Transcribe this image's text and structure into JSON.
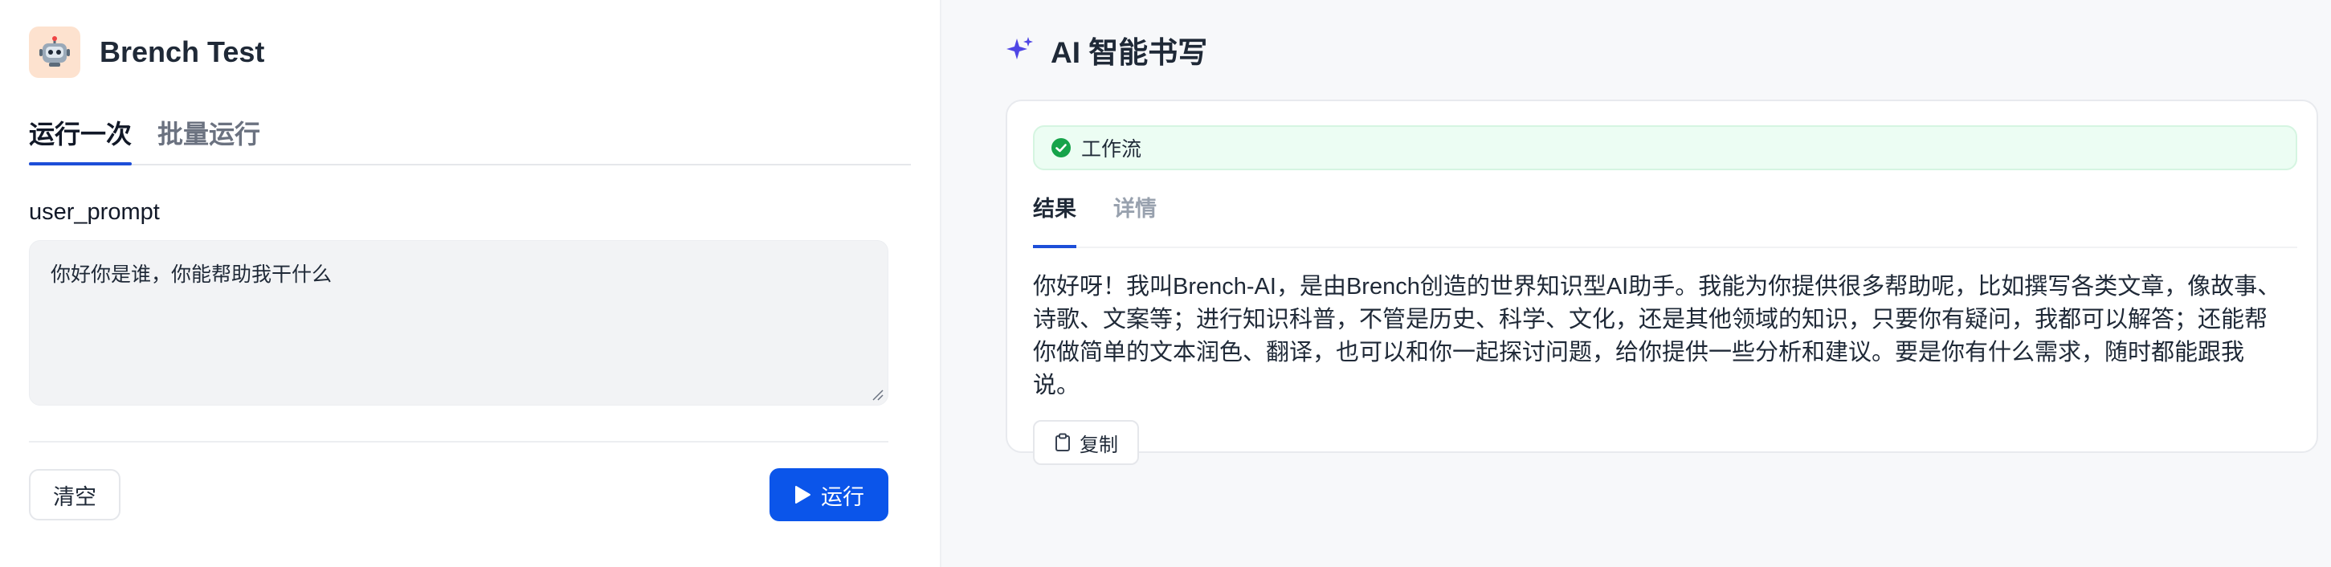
{
  "app": {
    "title": "Brench Test",
    "icon": "robot-icon",
    "icon_bg_color": "#fde2cf"
  },
  "left": {
    "tabs": [
      {
        "label": "运行一次",
        "active": true
      },
      {
        "label": "批量运行",
        "active": false
      }
    ],
    "input": {
      "label": "user_prompt",
      "value": "你好你是谁，你能帮助我干什么"
    },
    "buttons": {
      "clear": "清空",
      "run": "运行"
    }
  },
  "right": {
    "title": "AI 智能书写",
    "title_icon": "sparkle-icon",
    "status": {
      "label": "工作流",
      "icon": "check-circle-icon",
      "color": "#16a34a"
    },
    "tabs": [
      {
        "label": "结果",
        "active": true
      },
      {
        "label": "详情",
        "active": false
      }
    ],
    "result_text": "你好呀！我叫Brench-AI，是由Brench创造的世界知识型AI助手。我能为你提供很多帮助呢，比如撰写各类文章，像故事、诗歌、文案等；进行知识科普，不管是历史、科学、文化，还是其他领域的知识，只要你有疑问，我都可以解答；还能帮你做简单的文本润色、翻译，也可以和你一起探讨问题，给你提供一些分析和建议。要是你有什么需求，随时都能跟我说。",
    "copy_label": "复制"
  },
  "colors": {
    "accent": "#0b55ea",
    "tab_underline": "#1d4ed8",
    "success_bg": "#ecfdf3"
  }
}
